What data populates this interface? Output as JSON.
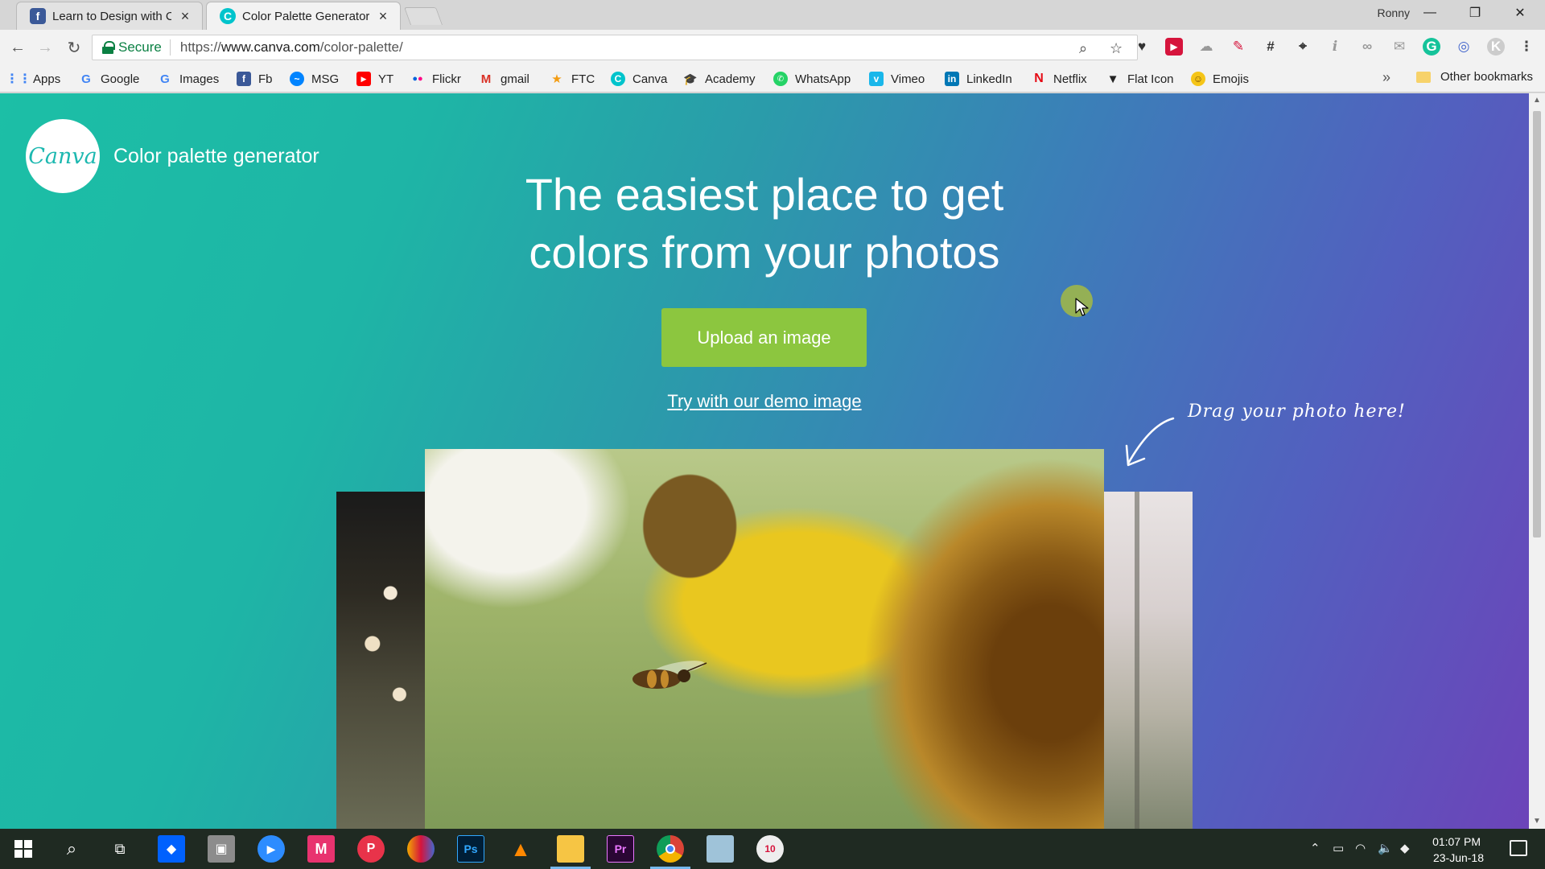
{
  "browser": {
    "tabs": [
      {
        "title": "Learn to Design with Canva",
        "favicon": "facebook-icon",
        "active": false
      },
      {
        "title": "Color Palette Generator",
        "favicon": "canva-icon",
        "active": true
      }
    ],
    "profile_name": "Ronny",
    "secure_label": "Secure",
    "url": {
      "scheme": "https://",
      "host": "www.canva.com",
      "path": "/color-palette/"
    },
    "bookmarks": [
      {
        "label": "Apps",
        "icon": "apps-grid-icon",
        "color": "#4285f4"
      },
      {
        "label": "Google",
        "icon": "google-icon",
        "color": "#4285f4"
      },
      {
        "label": "Images",
        "icon": "google-icon",
        "color": "#4285f4"
      },
      {
        "label": "Fb",
        "icon": "facebook-icon",
        "color": "#3b5998"
      },
      {
        "label": "MSG",
        "icon": "messenger-icon",
        "color": "#0084ff"
      },
      {
        "label": "YT",
        "icon": "youtube-icon",
        "color": "#ff0000"
      },
      {
        "label": "Flickr",
        "icon": "flickr-icon",
        "color": "#ff0084"
      },
      {
        "label": "gmail",
        "icon": "gmail-icon",
        "color": "#d93025"
      },
      {
        "label": "FTC",
        "icon": "ftc-icon",
        "color": "#f39c12"
      },
      {
        "label": "Canva",
        "icon": "canva-icon",
        "color": "#00c4cc"
      },
      {
        "label": "Academy",
        "icon": "academy-icon",
        "color": "#333333"
      },
      {
        "label": "WhatsApp",
        "icon": "whatsapp-icon",
        "color": "#25d366"
      },
      {
        "label": "Vimeo",
        "icon": "vimeo-icon",
        "color": "#1ab7ea"
      },
      {
        "label": "LinkedIn",
        "icon": "linkedin-icon",
        "color": "#0077b5"
      },
      {
        "label": "Netflix",
        "icon": "netflix-icon",
        "color": "#e50914"
      },
      {
        "label": "Flat Icon",
        "icon": "flaticon-icon",
        "color": "#222222"
      },
      {
        "label": "Emojis",
        "icon": "emoji-icon",
        "color": "#f5c518"
      }
    ],
    "bookmarks_overflow": "»",
    "other_bookmarks": "Other bookmarks"
  },
  "page": {
    "logo_text": "Canva",
    "site_title": "Color palette generator",
    "headline_line1": "The easiest place to get",
    "headline_line2": "colors from your photos",
    "upload_button": "Upload an image",
    "demo_link": "Try with our demo image",
    "drag_hint": "Drag your photo here!"
  },
  "taskbar": {
    "time": "01:07 PM",
    "date": "23-Jun-18",
    "apps": [
      {
        "name": "start-icon",
        "color": "#ffffff"
      },
      {
        "name": "search-icon",
        "color": "#ffffff"
      },
      {
        "name": "task-view-icon",
        "color": "#ffffff"
      },
      {
        "name": "dropbox-icon",
        "color": "#0061fe"
      },
      {
        "name": "file-explorer-tool-icon",
        "color": "#8c8c8c"
      },
      {
        "name": "zoom-icon",
        "color": "#2d8cff"
      },
      {
        "name": "m-app-icon",
        "color": "#e8336f"
      },
      {
        "name": "pocket-icon",
        "color": "#e8334a"
      },
      {
        "name": "colorful-app-icon",
        "color": "#f2a900"
      },
      {
        "name": "photoshop-icon",
        "color": "#001e36",
        "label": "Ps"
      },
      {
        "name": "vlc-icon",
        "color": "#ff8800"
      },
      {
        "name": "file-manager-icon",
        "color": "#f6c544"
      },
      {
        "name": "premiere-icon",
        "color": "#2a0634",
        "label": "Pr"
      },
      {
        "name": "chrome-icon",
        "color": "#4285f4"
      },
      {
        "name": "notepad-icon",
        "color": "#9fc3d9"
      },
      {
        "name": "notification-app-icon",
        "color": "#eeeeee"
      }
    ]
  }
}
